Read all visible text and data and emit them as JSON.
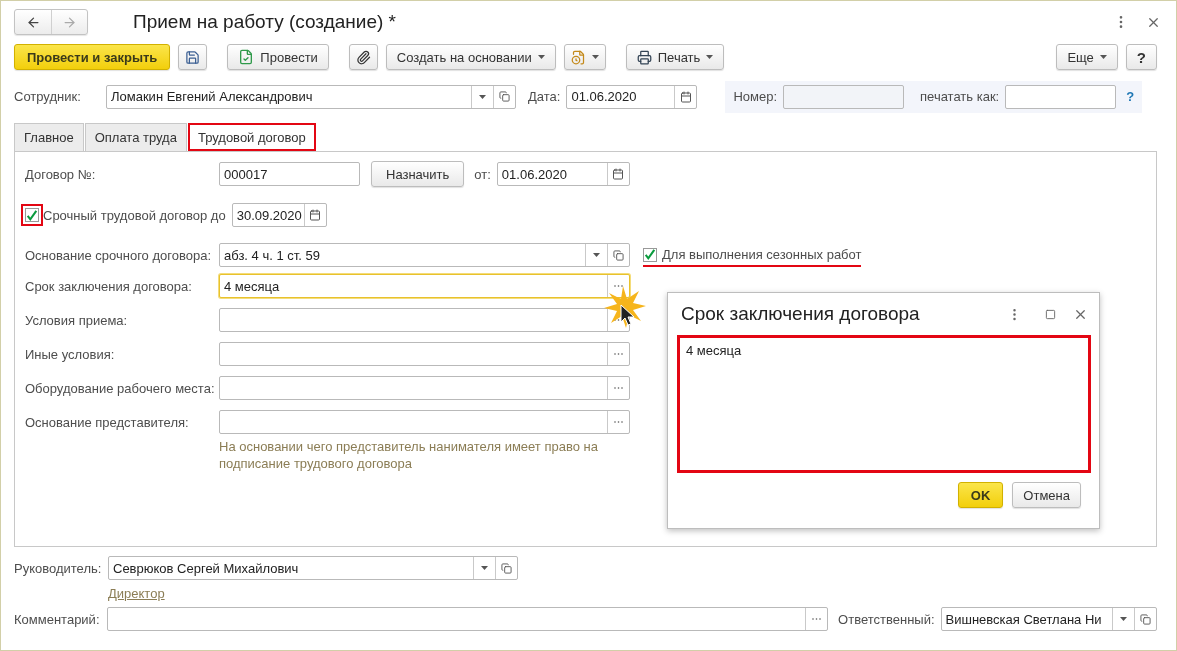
{
  "window": {
    "title": "Прием на работу (создание) *"
  },
  "toolbar": {
    "post_close": "Провести и закрыть",
    "post": "Провести",
    "create_based": "Создать на основании",
    "print": "Печать",
    "more": "Еще",
    "help": "?"
  },
  "header": {
    "employee": {
      "label": "Сотрудник:",
      "value": "Ломакин Евгений Александрович"
    },
    "date": {
      "label": "Дата:",
      "value": "01.06.2020"
    },
    "number": {
      "label": "Номер:",
      "disabled": true
    },
    "print_as": {
      "label": "печатать как:"
    },
    "help": "?"
  },
  "tabs": [
    {
      "label": "Главное",
      "selected": false,
      "highlighted": false
    },
    {
      "label": "Оплата труда",
      "selected": false,
      "highlighted": false
    },
    {
      "label": "Трудовой договор",
      "selected": true,
      "highlighted": true
    }
  ],
  "contract": {
    "number": {
      "label": "Договор №:",
      "value": "000017"
    },
    "assign": "Назначить",
    "from": {
      "label": "от:",
      "value": "01.06.2020"
    },
    "fixed_term": {
      "label": "Срочный трудовой договор до",
      "checked": true,
      "highlighted": true,
      "date": "30.09.2020"
    },
    "basis": {
      "label": "Основание срочного договора:",
      "value": "абз. 4 ч. 1 ст. 59"
    },
    "seasonal": {
      "label": "Для выполнения сезонных работ",
      "checked": true,
      "highlighted": true
    },
    "rows": [
      {
        "label": "Срок заключения договора:",
        "value": "4 месяца",
        "focused": true
      },
      {
        "label": "Условия приема:",
        "focused": false
      },
      {
        "label": "Иные условия:",
        "focused": false
      },
      {
        "label": "Оборудование рабочего места:",
        "focused": false
      },
      {
        "label": "Основание представителя:",
        "focused": false
      }
    ],
    "hint": "На основании чего представитель нанимателя имеет право на подписание трудового договора"
  },
  "footer": {
    "manager": {
      "label": "Руководитель:",
      "value": "Севрюков Сергей Михайлович"
    },
    "position": "Директор",
    "comment": {
      "label": "Комментарий:"
    },
    "responsible": {
      "label": "Ответственный:",
      "value": "Вишневская Светлана Ни"
    }
  },
  "dialog": {
    "title": "Срок заключения договора",
    "text": "4 месяца",
    "highlighted": true,
    "ok": "OK",
    "cancel": "Отмена"
  }
}
